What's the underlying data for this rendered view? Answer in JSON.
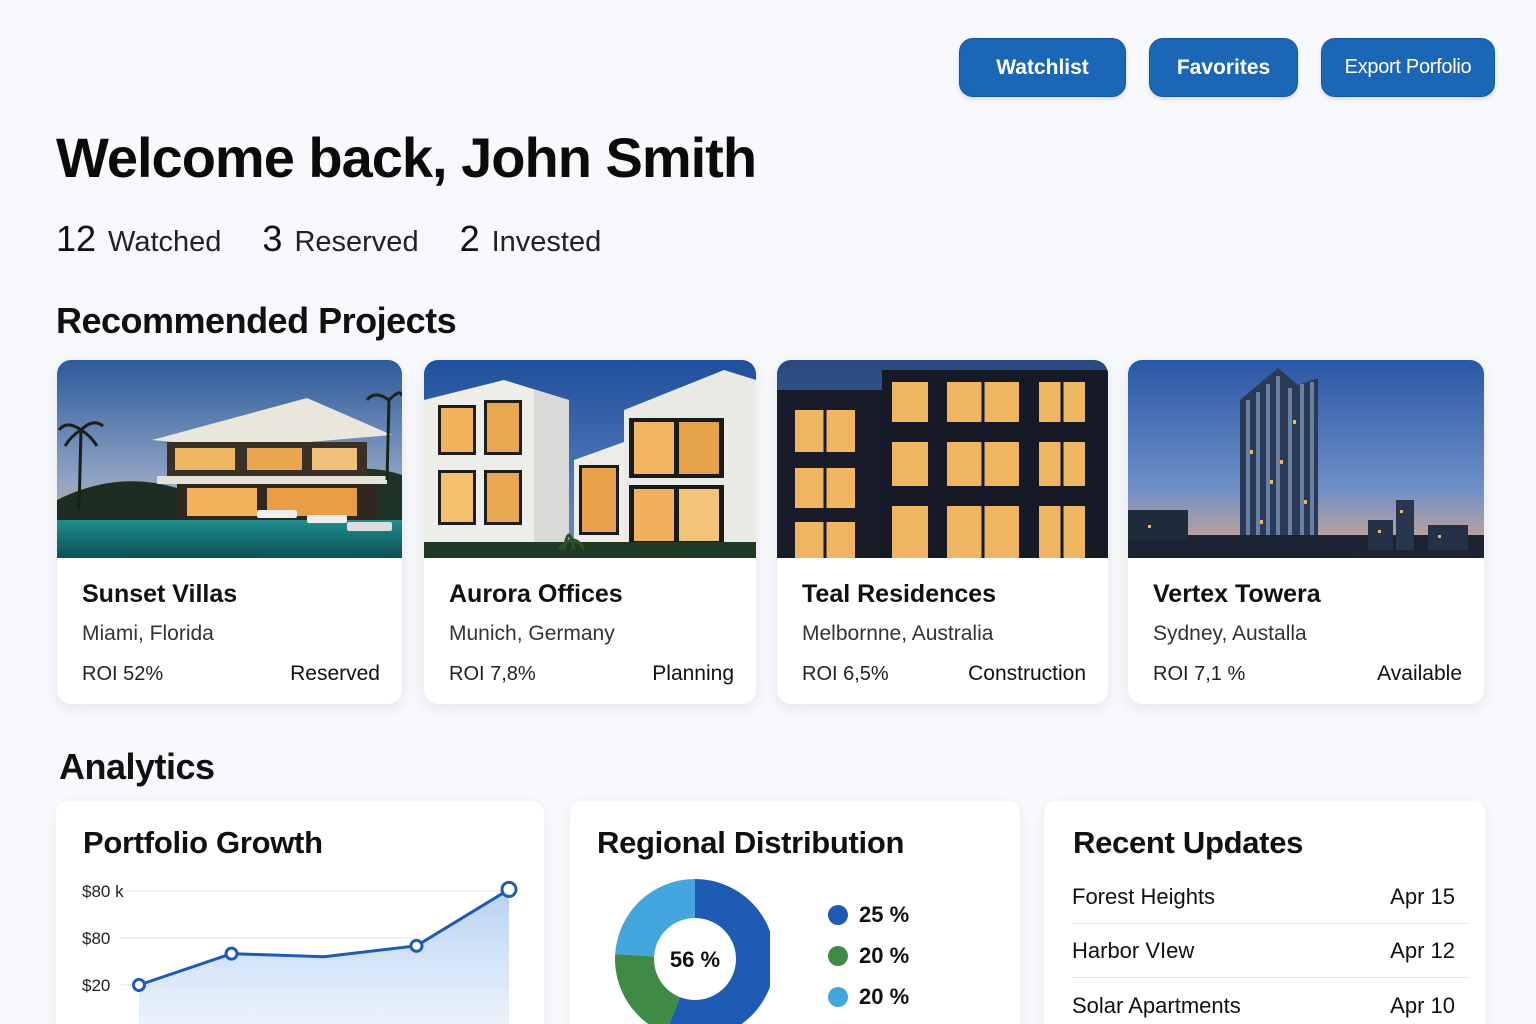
{
  "header": {
    "watchlist_label": "Watchlist",
    "favorites_label": "Favorites",
    "export_label": "Export Porfolio",
    "welcome": "Welcome back, John Smith"
  },
  "stats": [
    {
      "num": "12",
      "label": "Watched"
    },
    {
      "num": "3",
      "label": "Reserved"
    },
    {
      "num": "2",
      "label": "Invested"
    }
  ],
  "recommended": {
    "title": "Recommended Projects",
    "projects": [
      {
        "name": "Sunset Villas",
        "location": "Miami, Florida",
        "roi": "ROI 52%",
        "status": "Reserved"
      },
      {
        "name": "Aurora Offices",
        "location": "Munich, Germany",
        "roi": "ROI 7,8%",
        "status": "Planning"
      },
      {
        "name": "Teal Residences",
        "location": "Melbornne, Australia",
        "roi": "ROI 6,5%",
        "status": "Construction"
      },
      {
        "name": "Vertex Towera",
        "location": "Sydney, Austalla",
        "roi": "ROI 7,1 %",
        "status": "Available"
      }
    ]
  },
  "analytics": {
    "title": "Analytics",
    "growth": {
      "title": "Portfolio Growth"
    },
    "regional": {
      "title": "Regional Distribution",
      "center_label": "56 %",
      "legend": [
        {
          "label": "25 %",
          "color": "#1f5bb5"
        },
        {
          "label": "20 %",
          "color": "#3f8a45"
        },
        {
          "label": "20 %",
          "color": "#43a6de"
        }
      ]
    },
    "updates": {
      "title": "Recent Updates",
      "items": [
        {
          "name": "Forest Heights",
          "date": "Apr 15"
        },
        {
          "name": "Harbor VIew",
          "date": "Apr 12"
        },
        {
          "name": "Solar Apartments",
          "date": "Apr 10"
        }
      ]
    }
  },
  "chart_data": [
    {
      "type": "line",
      "title": "Portfolio Growth",
      "y_tick_labels": [
        "$80 k",
        "$80",
        "$20"
      ],
      "x": [
        1,
        2,
        3,
        4,
        5
      ],
      "values": [
        20,
        40,
        38,
        45,
        81
      ],
      "markers_at": [
        1,
        2,
        4,
        5
      ],
      "line_color": "#1f5bb5"
    },
    {
      "type": "pie",
      "title": "Regional Distribution",
      "center_label": "56 %",
      "slices": [
        {
          "label": "25 %",
          "value": 56,
          "color": "#1f5bb5"
        },
        {
          "label": "20 %",
          "value": 20,
          "color": "#3f8a45"
        },
        {
          "label": "20 %",
          "value": 24,
          "color": "#43a6de"
        }
      ]
    }
  ]
}
